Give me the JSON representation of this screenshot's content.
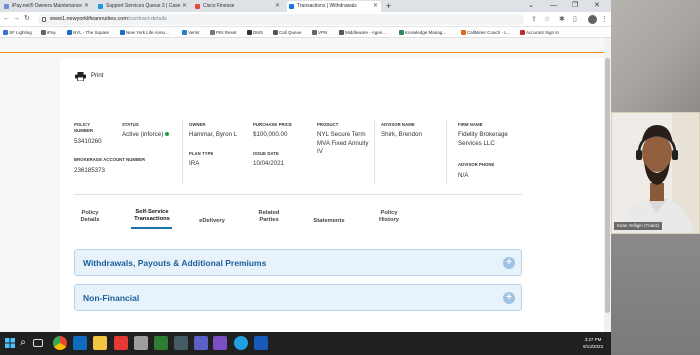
{
  "browser": {
    "tabs": [
      {
        "label": "iPay.net® Owners Maintenance",
        "color": "#6b8fd6"
      },
      {
        "label": "Support Services Queue 3 | Case",
        "color": "#1a9cd8"
      },
      {
        "label": "Cisco Finesse",
        "color": "#e44c3a"
      },
      {
        "label": "Transactions | Withdrawals",
        "color": "#1a73e8"
      }
    ],
    "new_tab": "+",
    "url_host": "www1.newyorklifeannuities.com",
    "url_path": "/contract-details",
    "bookmarks": [
      {
        "label": "SF Lighting",
        "color": "#3f6fd1"
      },
      {
        "label": "iPay",
        "color": "#666666"
      },
      {
        "label": "NYL - The Square",
        "color": "#1f6fbf"
      },
      {
        "label": "New York Life Annu...",
        "color": "#1f6fbf"
      },
      {
        "label": "Verint",
        "color": "#2a7ec9"
      },
      {
        "label": "PIN Reset",
        "color": "#777777"
      },
      {
        "label": "DMS",
        "color": "#333333"
      },
      {
        "label": "Call Queue",
        "color": "#555555"
      },
      {
        "label": "VPN",
        "color": "#666666"
      },
      {
        "label": "Middleware - Agen...",
        "color": "#555555"
      },
      {
        "label": "Knowledge Manag...",
        "color": "#2e8b57"
      },
      {
        "label": "CallMiner Coach - L...",
        "color": "#e06a1b"
      },
      {
        "label": "Accurant Sign In",
        "color": "#c62828"
      }
    ]
  },
  "page": {
    "print_label": "Print",
    "fields": {
      "policy_number_label": "POLICY NUMBER",
      "policy_number": "53410260",
      "status_label": "STATUS",
      "status": "Active (inforce)",
      "owner_label": "OWNER",
      "owner": "Hammar, Byron L",
      "purchase_price_label": "PURCHASE PRICE",
      "purchase_price": "$100,000.00",
      "product_label": "PRODUCT",
      "product": "NYL Secure Term MVA Fixed Annuity IV",
      "advisor_name_label": "ADVISOR NAME",
      "advisor_name": "Shirk, Brendon",
      "firm_name_label": "FIRM NAME",
      "firm_name": "Fidelity Brokerage Services LLC",
      "brokerage_account_label": "BROKERAGE ACCOUNT NUMBER",
      "brokerage_account": "236185373",
      "plan_type_label": "PLAN TYPE",
      "plan_type": "IRA",
      "issue_date_label": "ISSUE DATE",
      "issue_date": "10/04/2021",
      "advisor_phone_label": "ADVISOR PHONE",
      "advisor_phone": "N/A"
    },
    "tabs": [
      {
        "label": "Policy Details"
      },
      {
        "label": "Self-Service Transactions"
      },
      {
        "label": "eDelivery"
      },
      {
        "label": "Related Parties"
      },
      {
        "label": "Statements"
      },
      {
        "label": "Policy History"
      }
    ],
    "active_tab": "Self-Service Transactions",
    "accordions": [
      {
        "title": "Withdrawals, Payouts & Additional Premiums"
      },
      {
        "title": "Non-Financial"
      }
    ]
  },
  "taskbar": {
    "time": "3:27 PM",
    "date": "9/13/2023"
  },
  "video": {
    "participant_name": "Kiran Yelligiri (Trianz)"
  },
  "colors": {
    "accent_orange": "#f08a24",
    "accordion_title": "#1b5e9c",
    "active_tab_underline": "#1a73a8",
    "status_green": "#1e9e4a"
  }
}
